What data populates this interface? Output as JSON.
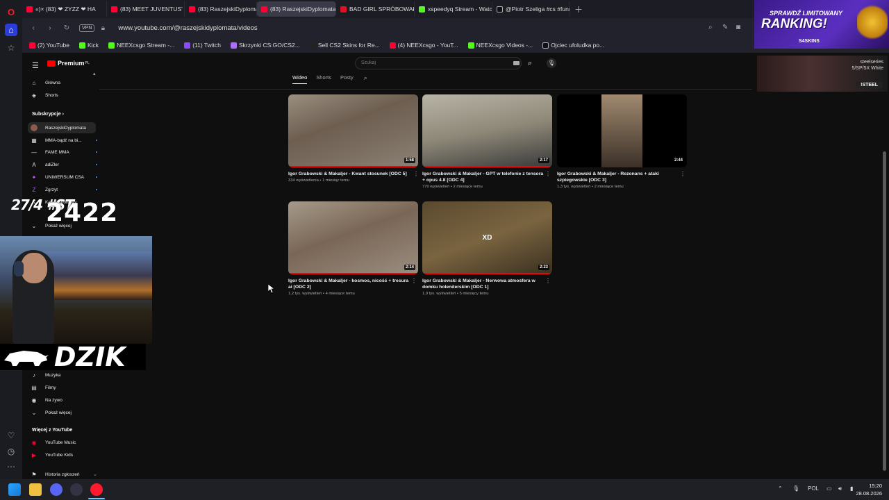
{
  "browser": {
    "tabs": [
      {
        "label": "«)× (83) ❤ ZYZZ ❤ HA"
      },
      {
        "label": "(83) MEET JUVENTUS' NE"
      },
      {
        "label": "(83) RaszejskiDyplomata"
      },
      {
        "label": "(83) RaszejskiDyplomata"
      },
      {
        "label": "BAD GIRL SPRÓBOWAŁA"
      },
      {
        "label": "xspeedyq Stream - Watch"
      },
      {
        "label": "@Piotr Szeliga #cs #funny"
      }
    ],
    "vpn_label": "VPN",
    "url": "www.youtube.com/@raszejskidyplomata/videos",
    "bookmarks": [
      {
        "label": "(2) YouTube",
        "color": "#ff0033"
      },
      {
        "label": "Kick",
        "color": "#53fc18"
      },
      {
        "label": "NEEXcsgo Stream -...",
        "color": "#53fc18"
      },
      {
        "label": "(11) Twitch",
        "color": "#9146ff"
      },
      {
        "label": "Skrzynki CS:GO/CS2...",
        "color": "#b06cff"
      },
      {
        "label": "Sell CS2 Skins for Re...",
        "color": "#222222"
      },
      {
        "label": "(4) NEEXcsgo - YouT...",
        "color": "#ff0033"
      },
      {
        "label": "NEEXcsgo Videos -...",
        "color": "#53fc18"
      },
      {
        "label": "Ojciec ufoludka po...",
        "color": "#111111"
      }
    ]
  },
  "youtube": {
    "logo": "Premium",
    "logo_sup": "PL",
    "sidebar": {
      "main": [
        {
          "label": "Główna",
          "icon": "⌂"
        },
        {
          "label": "Shorts",
          "icon": "◈"
        }
      ],
      "subs_heading": "Subskrypcje",
      "subs": [
        {
          "label": "RaszejskiDyplomata"
        },
        {
          "label": "MMA-bądź na bi..."
        },
        {
          "label": "FAME MMA"
        },
        {
          "label": "adiZler"
        },
        {
          "label": "UNIWERSUM CSA"
        },
        {
          "label": "Zgrzyt"
        },
        {
          "label": "Kanał Sportowy"
        },
        {
          "label": "Pokaż więcej"
        }
      ],
      "explore": [
        {
          "label": "Muzyka",
          "icon": "♪"
        },
        {
          "label": "Filmy",
          "icon": "▤"
        },
        {
          "label": "Na żywo",
          "icon": "◉"
        },
        {
          "label": "Pokaż więcej",
          "icon": "⌵"
        }
      ],
      "more_heading": "Więcej z YouTube",
      "more": [
        {
          "label": "YouTube Music"
        },
        {
          "label": "YouTube Kids"
        }
      ],
      "bottom": {
        "label": "Historia zgłoszeń"
      }
    },
    "search_placeholder": "Szukaj",
    "channel_tabs": [
      "Wideo",
      "Shorts",
      "Posty"
    ],
    "videos": [
      {
        "title": "Igor Grabowski & Makaljer - Kwant stosunek [ODC 5]",
        "meta": "334 wyświetlenia • 1 miesiąc temu",
        "duration": "1:58",
        "progress": 1.0,
        "overlay": ""
      },
      {
        "title": "Igor Grabowski & Makaljer - GPT w telefonie z tensora + opus 4.8 [ODC 4]",
        "meta": "770 wyświetleń • 2 miesiące temu",
        "duration": "2:17",
        "progress": 1.0,
        "overlay": ""
      },
      {
        "title": "Igor Grabowski & Makaljer - Rezonans + ataki szpiegowskie [ODC 3]",
        "meta": "1,3 tys. wyświetleń • 2 miesiące temu",
        "duration": "2:44",
        "progress": 0.0,
        "overlay": ""
      },
      {
        "title": "Igor Grabowski & Makaljer - kosmos, nicość + tresura ai [ODC 2]",
        "meta": "1,2 tys. wyświetleń • 4 miesiące temu",
        "duration": "2:14",
        "progress": 1.0,
        "overlay": ""
      },
      {
        "title": "Igor Grabowski & Makaljer - Nerwowa atmosfera w domku holenderskim [ODC 1]",
        "meta": "1,9 tys. wyświetleń • 5 miesięcy temu",
        "duration": "2:23",
        "progress": 1.0,
        "overlay": "XD"
      }
    ]
  },
  "overlays": {
    "counter_small": "27/4 #ST",
    "counter_big": "2422",
    "dzik": "DZIK",
    "promo_line1": "SPRAWDŹ LIMITOWANY",
    "promo_line2": "RANKING!",
    "promo_brand": "S4SKINS",
    "steel_label": "steelseries",
    "steel_model": "5/SP/5X White",
    "steel_code": "!STEEL"
  },
  "taskbar": {
    "tray_lang": "POL",
    "time": "15:20",
    "date": "28.08.2026"
  }
}
